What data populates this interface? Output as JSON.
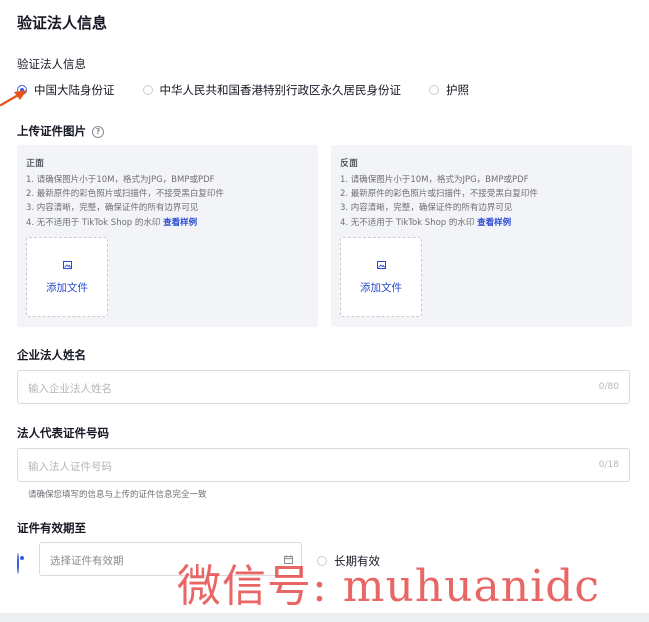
{
  "page": {
    "title": "验证法人信息"
  },
  "id_type": {
    "label": "验证法人信息",
    "options": [
      "中国大陆身份证",
      "中华人民共和国香港特别行政区永久居民身份证",
      "护照"
    ],
    "selected": "中国大陆身份证"
  },
  "upload": {
    "label": "上传证件图片",
    "help_icon": "help-circle-icon",
    "front": {
      "title": "正面",
      "rules": [
        "1. 请确保图片小于10M，格式为JPG，BMP或PDF",
        "2. 最新原件的彩色照片或扫描件，不接受黑白复印件",
        "3. 内容清晰，完整，确保证件的所有边界可见"
      ],
      "rule4": "4. 无不适用于 TikTok Shop 的水印 ",
      "sample_link": "查看样例",
      "button": "添加文件",
      "icon": "image-icon"
    },
    "back": {
      "title": "反面",
      "rules": [
        "1. 请确保图片小于10M，格式为JPG，BMP或PDF",
        "2. 最新原件的彩色照片或扫描件，不接受黑白复印件",
        "3. 内容清晰，完整，确保证件的所有边界可见"
      ],
      "rule4": "4. 无不适用于 TikTok Shop 的水印 ",
      "sample_link": "查看样例",
      "button": "添加文件",
      "icon": "image-icon"
    }
  },
  "name_field": {
    "label": "企业法人姓名",
    "placeholder": "输入企业法人姓名",
    "counter": "0/80"
  },
  "id_field": {
    "label": "法人代表证件号码",
    "placeholder": "输入法人证件号码",
    "counter": "0/18",
    "note": "请确保您填写的信息与上传的证件信息完全一致"
  },
  "validity": {
    "label": "证件有效期至",
    "date_placeholder": "选择证件有效期",
    "long_term": "长期有效",
    "calendar_icon": "calendar-icon"
  },
  "annotation": {
    "arrow_color": "#e8541c"
  },
  "watermark": {
    "text": "微信号: muhuanidc",
    "color": "#e54545"
  },
  "colors": {
    "accent": "#2a4bd0",
    "radio": "#3a5bd9",
    "panel_bg": "#f3f4f7"
  }
}
